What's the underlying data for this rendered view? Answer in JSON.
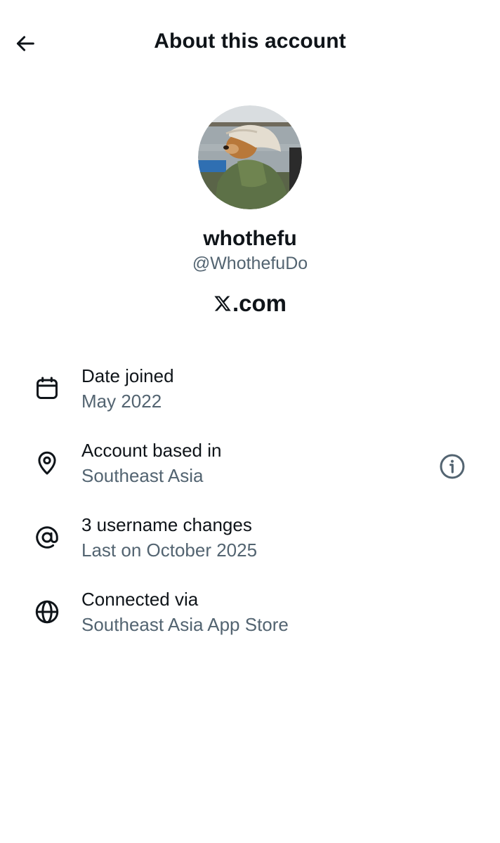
{
  "header": {
    "title": "About this account",
    "back_icon": "arrow-left-icon"
  },
  "profile": {
    "display_name": "whothefu",
    "handle": "@WhothefuDo",
    "site_suffix": ".com",
    "site_logo": "x-logo-icon"
  },
  "details": [
    {
      "icon": "calendar-icon",
      "title": "Date joined",
      "subtitle": "May 2022"
    },
    {
      "icon": "location-pin-icon",
      "title": "Account based in",
      "subtitle": "Southeast Asia",
      "action_icon": "info-icon"
    },
    {
      "icon": "at-sign-icon",
      "title": "3 username changes",
      "subtitle": "Last on October 2025"
    },
    {
      "icon": "globe-icon",
      "title": "Connected via",
      "subtitle": "Southeast Asia App Store"
    }
  ],
  "colors": {
    "text_primary": "#0f1419",
    "text_secondary": "#536471",
    "background": "#ffffff"
  }
}
